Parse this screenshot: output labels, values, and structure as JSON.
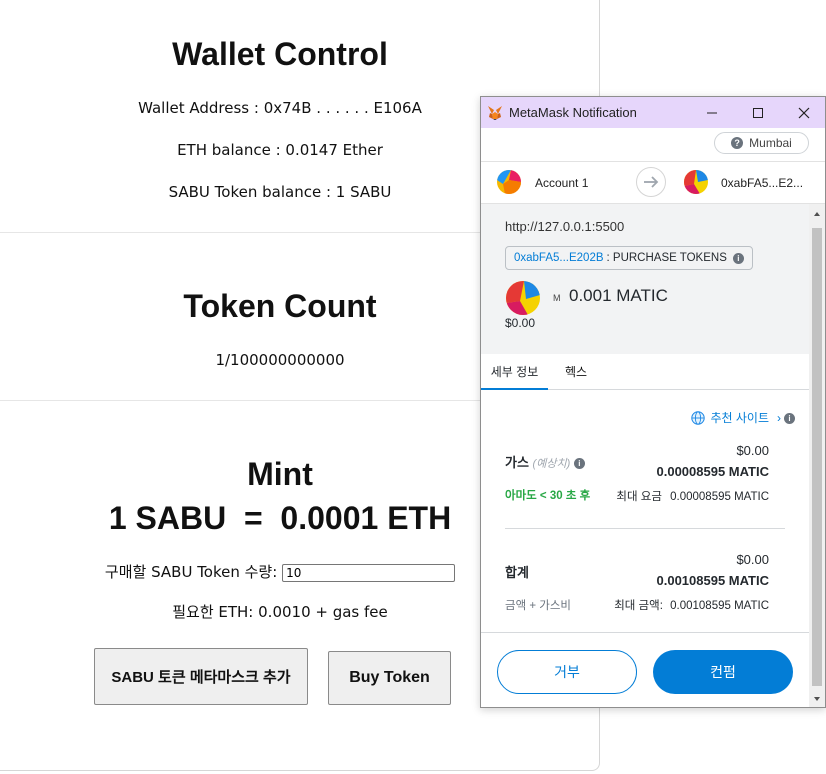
{
  "wallet": {
    "title": "Wallet Control",
    "address_line": "Wallet Address : 0x74B . . . . . . E106A",
    "eth_line": "ETH balance : 0.0147 Ether",
    "token_line": "SABU Token balance : 1 SABU"
  },
  "token_count": {
    "title": "Token Count",
    "value": "1/100000000000"
  },
  "mint": {
    "title": "Mint",
    "rate": "1 SABU  =  0.0001 ETH",
    "qty_label": "구매할 SABU Token 수량:",
    "qty_value": "10",
    "required": "필요한 ETH: 0.0010 + gas fee",
    "add_button": "SABU 토큰 메타마스크 추가",
    "buy_button": "Buy Token"
  },
  "metamask": {
    "window_title": "MetaMask Notification",
    "network": "Mumbai",
    "account_name": "Account 1",
    "to_address": "0xabFA5...E2...",
    "origin": "http://127.0.0.1:5500",
    "contract_link": "0xabFA5...E202B",
    "method": ": PURCHASE TOKENS",
    "amount_prefix": "M",
    "amount": "0.001 MATIC",
    "amount_fiat": "$0.00",
    "tabs": [
      "세부 정보",
      "헥스"
    ],
    "recommended_site": "추천 사이트",
    "gas": {
      "label": "가스",
      "estimated": "(예상치)",
      "fiat": "$0.00",
      "matic": "0.00008595 MATIC",
      "time_label": "아마도 < 30 초 후",
      "max_label": "최대 요금",
      "max_value": "0.00008595 MATIC"
    },
    "total": {
      "label": "합계",
      "fiat": "$0.00",
      "matic": "0.00108595 MATIC",
      "sub_label": "금액 + 가스비",
      "max_label": "최대 금액:",
      "max_value": "0.00108595 MATIC"
    },
    "reject": "거부",
    "confirm": "컨펌",
    "colors": {
      "accent": "#037dd6",
      "title_bar": "#e6d6fb",
      "success": "#28a745"
    }
  }
}
